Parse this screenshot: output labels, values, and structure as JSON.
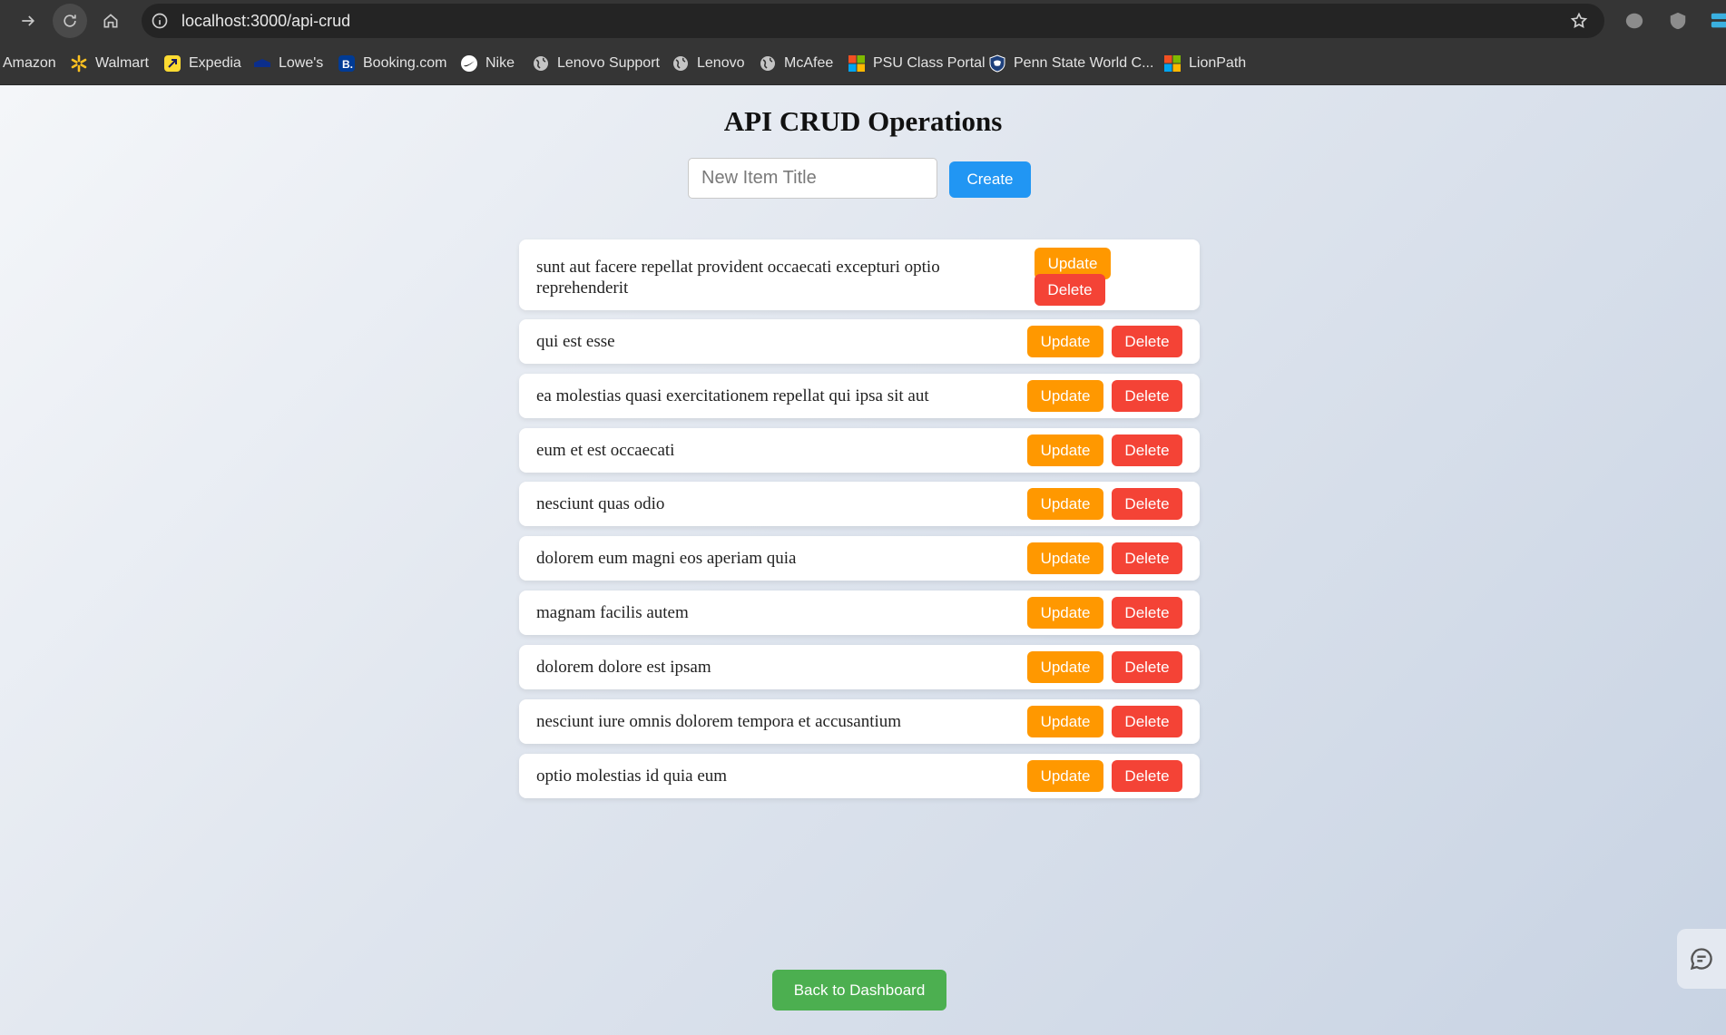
{
  "browser": {
    "url": "localhost:3000/api-crud",
    "bookmarks": [
      {
        "label": "Amazon",
        "icon": "none"
      },
      {
        "label": "Walmart",
        "icon": "walmart-spark-icon"
      },
      {
        "label": "Expedia",
        "icon": "expedia-icon"
      },
      {
        "label": "Lowe's",
        "icon": "lowes-icon"
      },
      {
        "label": "Booking.com",
        "icon": "booking-icon"
      },
      {
        "label": "Nike",
        "icon": "nike-icon"
      },
      {
        "label": "Lenovo Support",
        "icon": "globe-icon"
      },
      {
        "label": "Lenovo",
        "icon": "globe-icon"
      },
      {
        "label": "McAfee",
        "icon": "globe-icon"
      },
      {
        "label": "PSU Class Portal",
        "icon": "microsoft-icon"
      },
      {
        "label": "Penn State World C...",
        "icon": "psu-shield-icon"
      },
      {
        "label": "LionPath",
        "icon": "microsoft-icon"
      }
    ]
  },
  "page": {
    "title": "API CRUD Operations",
    "input_placeholder": "New Item Title",
    "input_value": "",
    "create_label": "Create",
    "update_label": "Update",
    "delete_label": "Delete",
    "back_label": "Back to Dashboard",
    "items": [
      "sunt aut facere repellat provident occaecati excepturi optio reprehenderit",
      "qui est esse",
      "ea molestias quasi exercitationem repellat qui ipsa sit aut",
      "eum et est occaecati",
      "nesciunt quas odio",
      "dolorem eum magni eos aperiam quia",
      "magnam facilis autem",
      "dolorem dolore est ipsam",
      "nesciunt iure omnis dolorem tempora et accusantium",
      "optio molestias id quia eum"
    ]
  },
  "colors": {
    "create": "#2196f3",
    "update": "#ff9800",
    "delete": "#f44336",
    "back": "#4caf50"
  }
}
